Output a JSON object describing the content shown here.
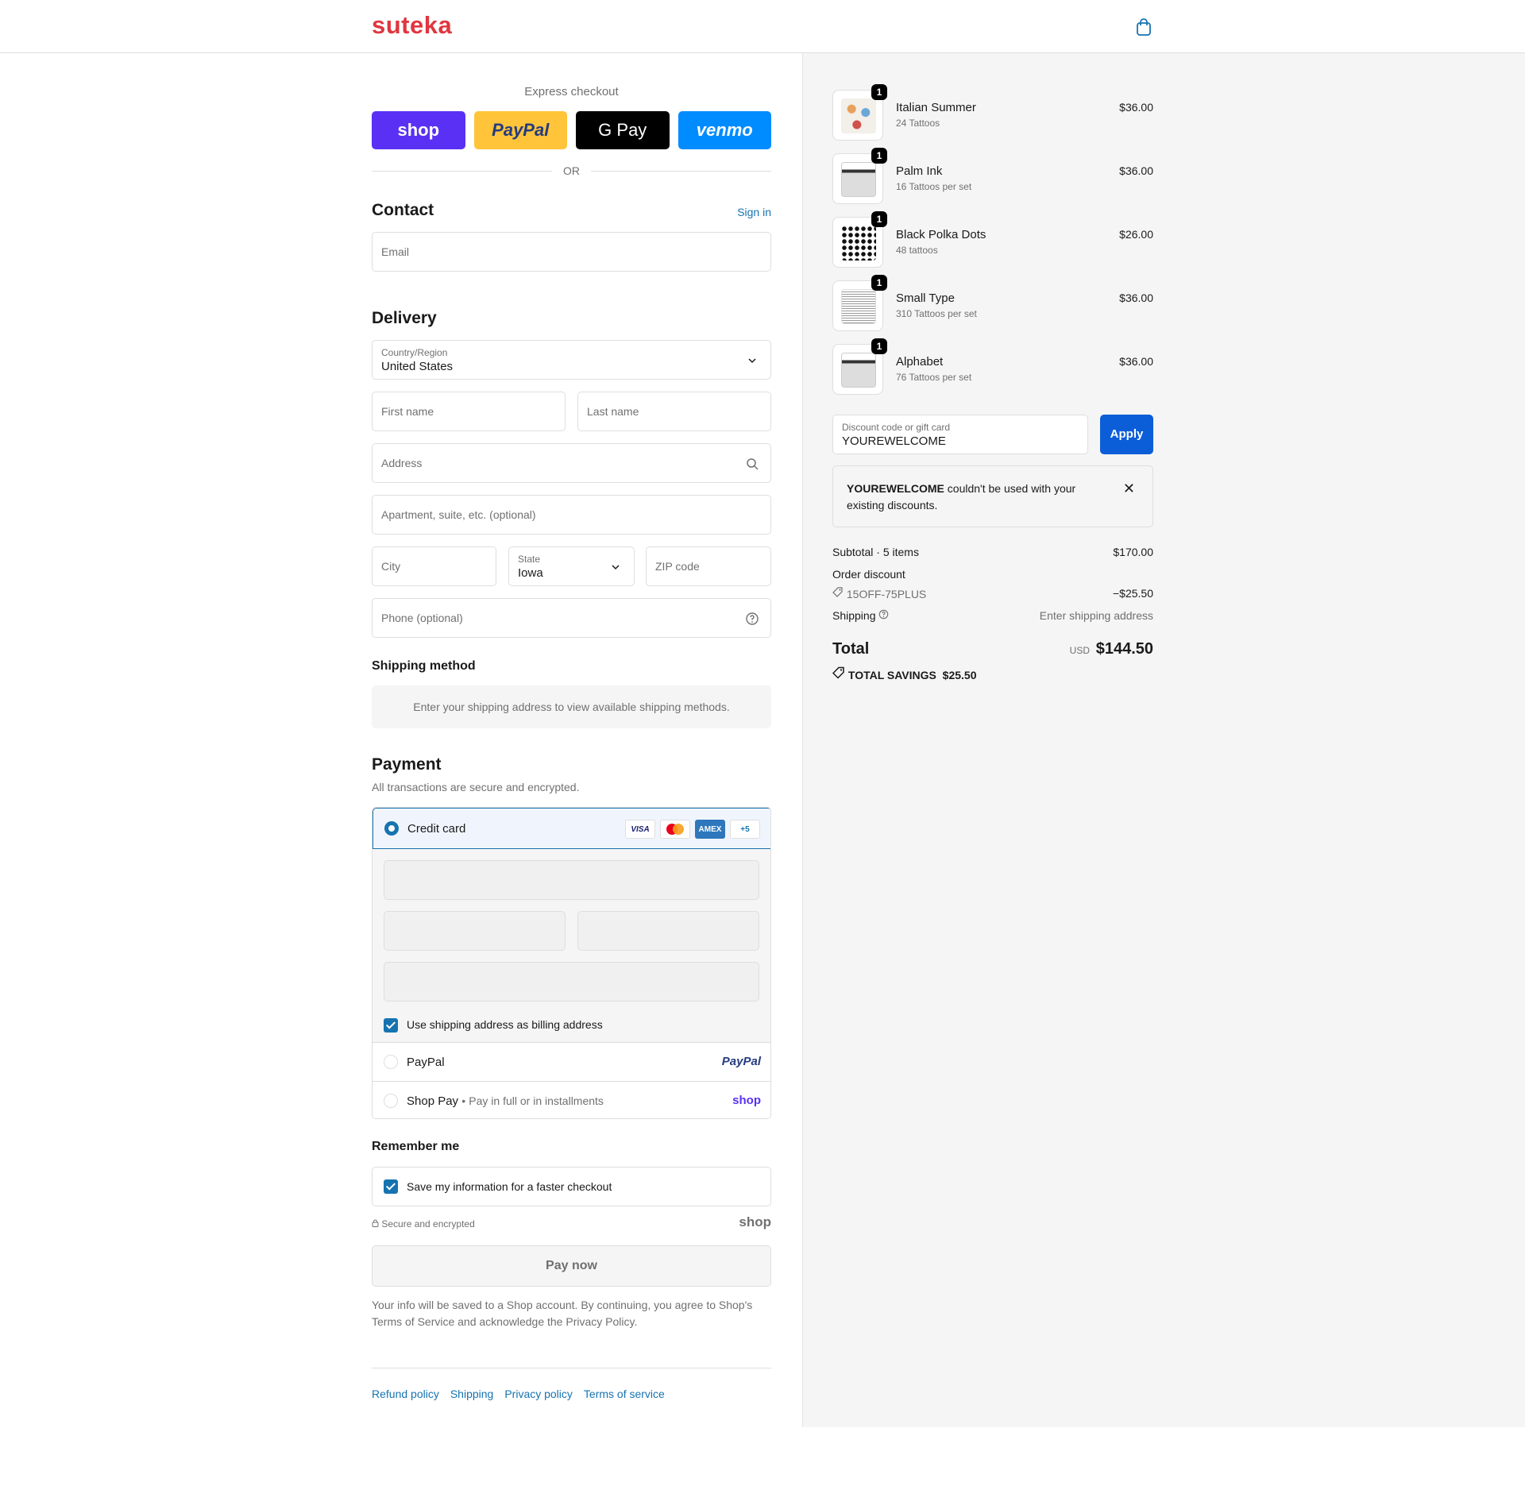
{
  "header": {
    "logo": "suteka"
  },
  "express": {
    "title": "Express checkout",
    "buttons": {
      "shop": "shop",
      "paypal": "PayPal",
      "gpay": "G Pay",
      "venmo": "venmo"
    },
    "or": "OR"
  },
  "contact": {
    "title": "Contact",
    "signin": "Sign in",
    "email_placeholder": "Email"
  },
  "delivery": {
    "title": "Delivery",
    "country_label": "Country/Region",
    "country_value": "United States",
    "first_name": "First name",
    "last_name": "Last name",
    "address": "Address",
    "apartment": "Apartment, suite, etc. (optional)",
    "city": "City",
    "state_label": "State",
    "state_value": "Iowa",
    "zip": "ZIP code",
    "phone": "Phone (optional)"
  },
  "shipping_method": {
    "title": "Shipping method",
    "note": "Enter your shipping address to view available shipping methods."
  },
  "payment": {
    "title": "Payment",
    "subtitle": "All transactions are secure and encrypted.",
    "credit_card": "Credit card",
    "cards": {
      "visa": "VISA",
      "amex": "AMEX",
      "more": "+5"
    },
    "billing_same": "Use shipping address as billing address",
    "paypal": "PayPal",
    "paypal_brand": "PayPal",
    "shoppay": "Shop Pay",
    "shoppay_sub": "Pay in full or in installments",
    "shoppay_brand": "shop"
  },
  "remember": {
    "title": "Remember me",
    "save": "Save my information for a faster checkout",
    "secure": "Secure and encrypted",
    "shop": "shop"
  },
  "paynow": "Pay now",
  "legal": {
    "text1": "Your info will be saved to a Shop account. By continuing, you agree to Shop's",
    "tos": "Terms of Service",
    "text2": "and acknowledge the",
    "privacy": "Privacy Policy",
    "text3": "."
  },
  "footer": {
    "refund": "Refund policy",
    "shipping": "Shipping",
    "privacy": "Privacy policy",
    "terms": "Terms of service"
  },
  "cart": {
    "items": [
      {
        "name": "Italian Summer",
        "variant": "24 Tattoos",
        "price": "$36.00",
        "qty": "1"
      },
      {
        "name": "Palm Ink",
        "variant": "16 Tattoos per set",
        "price": "$36.00",
        "qty": "1"
      },
      {
        "name": "Black Polka Dots",
        "variant": "48 tattoos",
        "price": "$26.00",
        "qty": "1"
      },
      {
        "name": "Small Type",
        "variant": "310 Tattoos per set",
        "price": "$36.00",
        "qty": "1"
      },
      {
        "name": "Alphabet",
        "variant": "76 Tattoos per set",
        "price": "$36.00",
        "qty": "1"
      }
    ],
    "discount_label": "Discount code or gift card",
    "discount_value": "YOUREWELCOME",
    "apply": "Apply",
    "error_code": "YOUREWELCOME",
    "error_text": "couldn't be used with your existing discounts.",
    "subtotal_label": "Subtotal · 5 items",
    "subtotal": "$170.00",
    "order_discount": "Order discount",
    "discount_code": "15OFF-75PLUS",
    "discount_amount": "−$25.50",
    "shipping_label": "Shipping",
    "shipping_value": "Enter shipping address",
    "total_label": "Total",
    "currency": "USD",
    "total": "$144.50",
    "savings_label": "TOTAL SAVINGS",
    "savings": "$25.50"
  }
}
